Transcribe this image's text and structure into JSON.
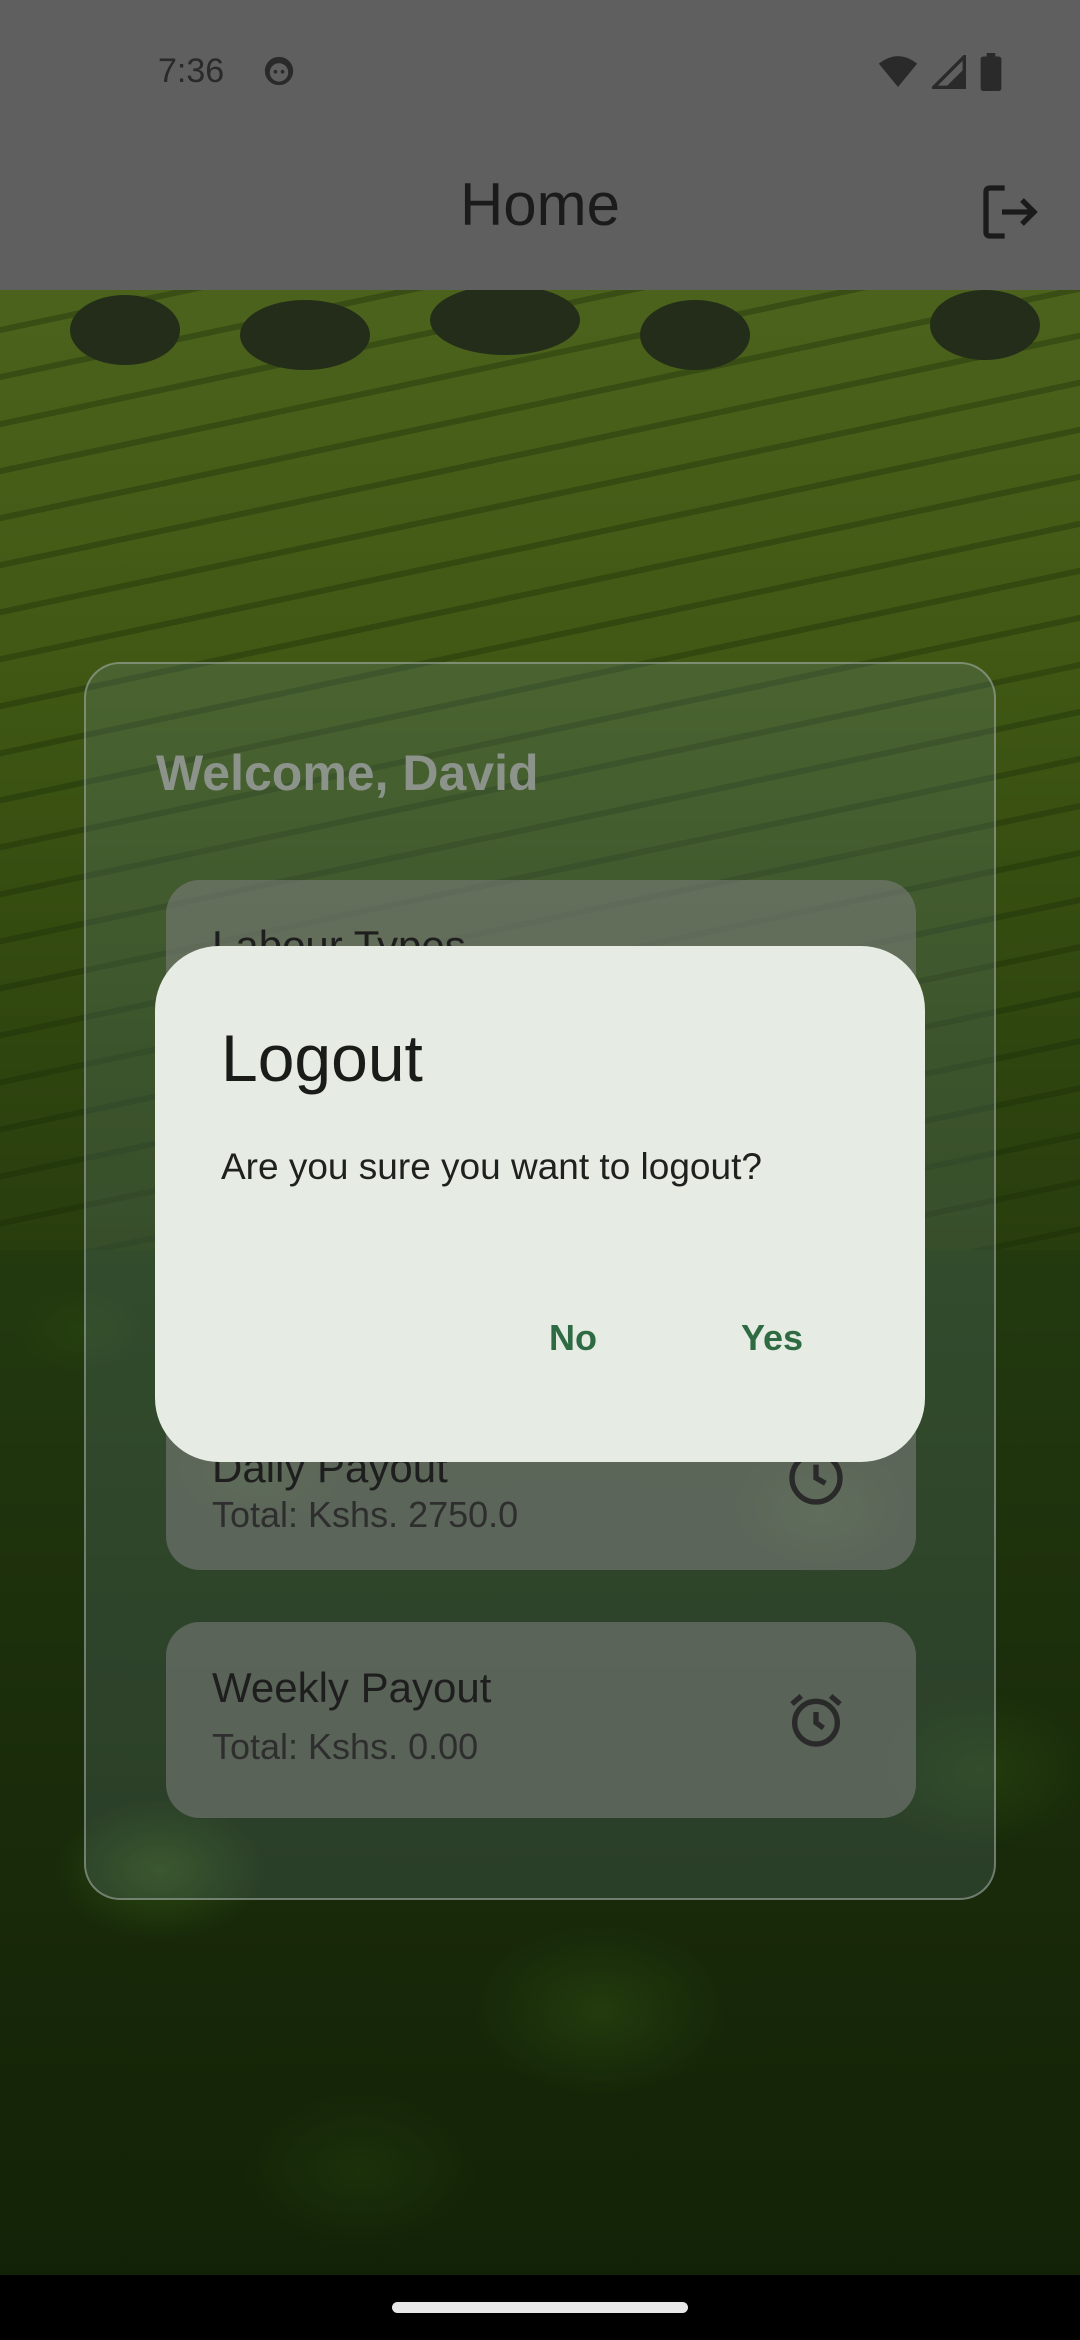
{
  "status_bar": {
    "time": "7:36",
    "icons": [
      "face-icon",
      "wifi-icon",
      "signal-icon",
      "battery-icon"
    ]
  },
  "app_bar": {
    "title": "Home",
    "action_icon": "logout-icon"
  },
  "card": {
    "welcome": "Welcome, David",
    "tiles": [
      {
        "title": "Labour Types",
        "subtitle": "",
        "icon": ""
      },
      {
        "title": "Daily Payout",
        "subtitle": "Total: Kshs. 2750.0",
        "icon": "clock-icon"
      },
      {
        "title": "Weekly Payout",
        "subtitle": "Total: Kshs. 0.00",
        "icon": "alarm-clock-icon"
      }
    ]
  },
  "dialog": {
    "title": "Logout",
    "message": "Are you sure you want to logout?",
    "no_label": "No",
    "yes_label": "Yes"
  },
  "colors": {
    "dialog_bg": "#e6ebe3",
    "accent": "#2f6b42",
    "bar_bg": "#5f5f5f"
  }
}
